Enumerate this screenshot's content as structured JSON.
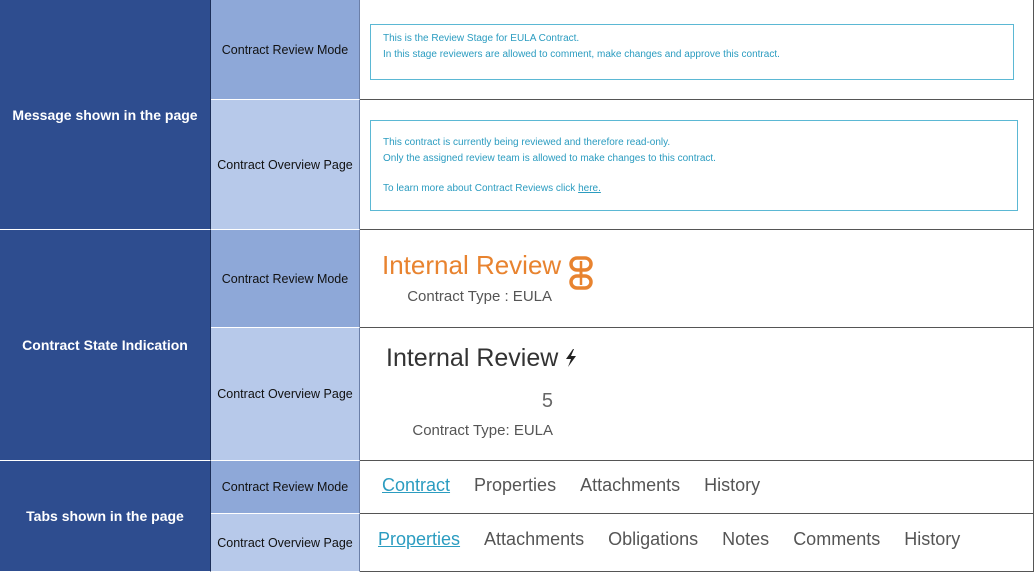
{
  "rows": {
    "message": {
      "category": "Message shown in the page",
      "review_mode_label": "Contract Review Mode",
      "overview_label": "Contract Overview Page",
      "review_msg": {
        "line1": "This is the Review Stage for EULA Contract.",
        "line2": "In this stage reviewers are allowed to comment, make changes and approve this contract."
      },
      "overview_msg": {
        "line1": "This contract is currently being reviewed and therefore read-only.",
        "line2": "Only the assigned review team is allowed to make changes to this contract.",
        "line3_prefix": "To learn more about Contract Reviews click ",
        "link": "here."
      }
    },
    "state": {
      "category": "Contract State Indication",
      "review_mode_label": "Contract Review Mode",
      "overview_label": "Contract Overview Page",
      "review": {
        "title": "Internal Review",
        "type": "Contract Type : EULA",
        "icon": "review-flow-icon",
        "color": "#e8832f"
      },
      "overview": {
        "title": "Internal Review",
        "number": "5",
        "type": "Contract Type: EULA",
        "icon": "lightning-icon"
      }
    },
    "tabs": {
      "category": "Tabs shown in the page",
      "review_mode_label": "Contract Review Mode",
      "overview_label": "Contract Overview Page",
      "review_tabs": [
        "Contract",
        "Properties",
        "Attachments",
        "History"
      ],
      "overview_tabs": [
        "Properties",
        "Attachments",
        "Obligations",
        "Notes",
        "Comments",
        "History"
      ]
    }
  },
  "colors": {
    "category_bg": "#2e4d8f",
    "label_dark": "#8ea8d8",
    "label_light": "#b7c9ea",
    "accent": "#2b9cc0"
  }
}
